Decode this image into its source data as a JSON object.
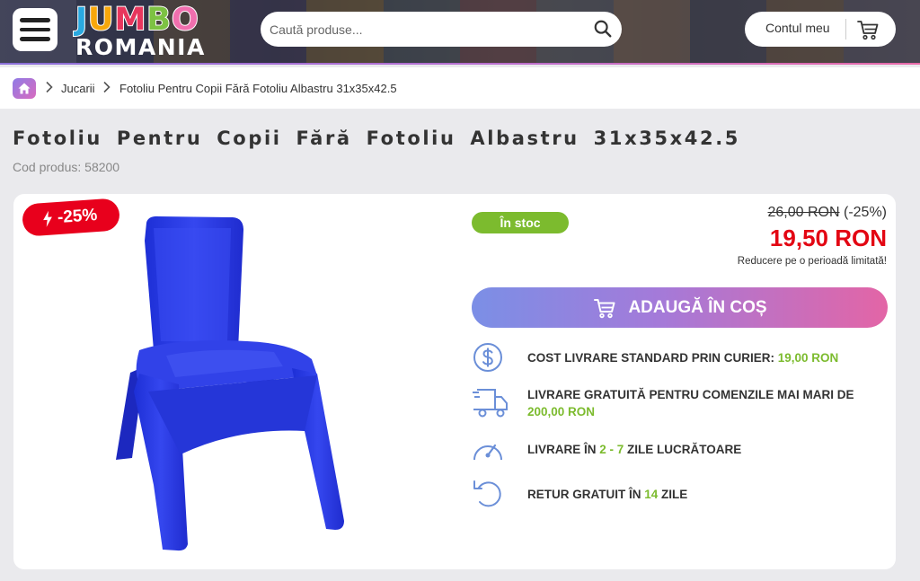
{
  "header": {
    "logo_top": "JUMBO",
    "logo_bottom": "ROMANIA",
    "search_placeholder": "Caută produse...",
    "account_label": "Contul meu"
  },
  "breadcrumb": {
    "items": [
      "Jucarii",
      "Fotoliu Pentru Copii Fără Fotoliu Albastru 31x35x42.5"
    ]
  },
  "product": {
    "title": "Fotoliu Pentru Copii Fără Fotoliu Albastru 31x35x42.5",
    "code_label": "Cod produs: 58200",
    "discount_badge": "-25%",
    "stock": "În stoc",
    "old_price": "26,00 RON",
    "old_price_discount": "(-25%)",
    "new_price": "19,50 RON",
    "promo_note": "Reducere pe o perioadă limitată!",
    "add_to_cart": "ADAUGĂ ÎN COȘ"
  },
  "delivery": {
    "shipping_text": "COST LIVRARE STANDARD PRIN CURIER: ",
    "shipping_value": "19,00 RON",
    "free_text": "LIVRARE GRATUITĂ PENTRU COMENZILE MAI MARI DE ",
    "free_value": "200,00 RON",
    "time_prefix": "LIVRARE ÎN ",
    "time_value": "2 - 7",
    "time_suffix": " ZILE LUCRĂTOARE",
    "return_prefix": "RETUR GRATUIT ÎN ",
    "return_value": "14",
    "return_suffix": " ZILE"
  },
  "colors": {
    "brand_gradient_start": "#7b8fe6",
    "brand_gradient_end": "#e365a6",
    "price_red": "#e30613",
    "stock_green": "#7cbb2e"
  }
}
